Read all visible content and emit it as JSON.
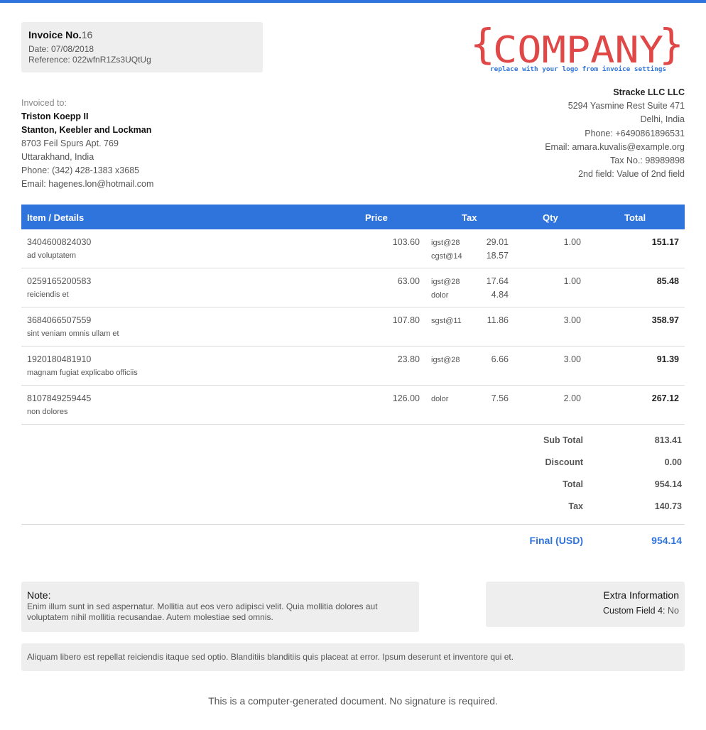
{
  "invoice": {
    "title": "Invoice No.",
    "number": "16",
    "date": "Date: 07/08/2018",
    "reference": "Reference: 022wfnR1Zs3UQtUg"
  },
  "logo": {
    "text": "COMPANY",
    "subtitle": "replace with your logo from invoice settings",
    "brace_open": "{",
    "brace_close": "}",
    "color": "#e04848",
    "subtitle_color": "#2f73dc"
  },
  "bill_to": {
    "label": "Invoiced to:",
    "name": "Triston Koepp II",
    "company": "Stanton, Keebler and Lockman",
    "address1": "8703 Feil Spurs Apt. 769",
    "address2": "Uttarakhand, India",
    "phone": "Phone: (342) 428-1383 x3685",
    "email": "Email: hagenes.lon@hotmail.com"
  },
  "seller": {
    "name": "Stracke LLC LLC",
    "address1": "5294 Yasmine Rest Suite 471",
    "address2": "Delhi, India",
    "phone": "Phone: +6490861896531",
    "email": "Email: amara.kuvalis@example.org",
    "tax_no": "Tax No.: 98989898",
    "field2": "2nd field: Value of 2nd field"
  },
  "table": {
    "headers": {
      "item": "Item / Details",
      "price": "Price",
      "tax": "Tax",
      "qty": "Qty",
      "total": "Total"
    },
    "rows": [
      {
        "code": "3404600824030",
        "desc": "ad voluptatem",
        "price": "103.60",
        "taxes": [
          {
            "name": "igst@28",
            "amount": "29.01"
          },
          {
            "name": "cgst@14",
            "amount": "18.57"
          }
        ],
        "qty": "1.00",
        "total": "151.17"
      },
      {
        "code": "0259165200583",
        "desc": "reiciendis et",
        "price": "63.00",
        "taxes": [
          {
            "name": "igst@28",
            "amount": "17.64"
          },
          {
            "name": "dolor",
            "amount": "4.84"
          }
        ],
        "qty": "1.00",
        "total": "85.48"
      },
      {
        "code": "3684066507559",
        "desc": "sint veniam omnis ullam et",
        "price": "107.80",
        "taxes": [
          {
            "name": "sgst@11",
            "amount": "11.86"
          }
        ],
        "qty": "3.00",
        "total": "358.97"
      },
      {
        "code": "1920180481910",
        "desc": "magnam fugiat explicabo officiis",
        "price": "23.80",
        "taxes": [
          {
            "name": "igst@28",
            "amount": "6.66"
          }
        ],
        "qty": "3.00",
        "total": "91.39"
      },
      {
        "code": "8107849259445",
        "desc": "non dolores",
        "price": "126.00",
        "taxes": [
          {
            "name": "dolor",
            "amount": "7.56"
          }
        ],
        "qty": "2.00",
        "total": "267.12"
      }
    ]
  },
  "totals": {
    "subtotal_label": "Sub Total",
    "subtotal": "813.41",
    "discount_label": "Discount",
    "discount": "0.00",
    "total_label": "Total",
    "total": "954.14",
    "tax_label": "Tax",
    "tax": "140.73",
    "final_label": "Final (USD)",
    "final": "954.14"
  },
  "note": {
    "title": "Note:",
    "body": "Enim illum sunt in sed aspernatur. Mollitia aut eos vero adipisci velit. Quia mollitia dolores aut voluptatem nihil mollitia recusandae. Autem molestiae sed omnis."
  },
  "extra": {
    "title": "Extra Information",
    "field_label": "Custom Field 4:",
    "field_value": "No"
  },
  "terms": "Aliquam libero est repellat reiciendis itaque sed optio. Blanditiis blanditiis quis placeat at error. Ipsum deserunt et inventore qui et.",
  "footer": "This is a computer-generated document. No signature is required.",
  "colors": {
    "accent": "#2f73dc",
    "panel": "#eeeeee"
  }
}
